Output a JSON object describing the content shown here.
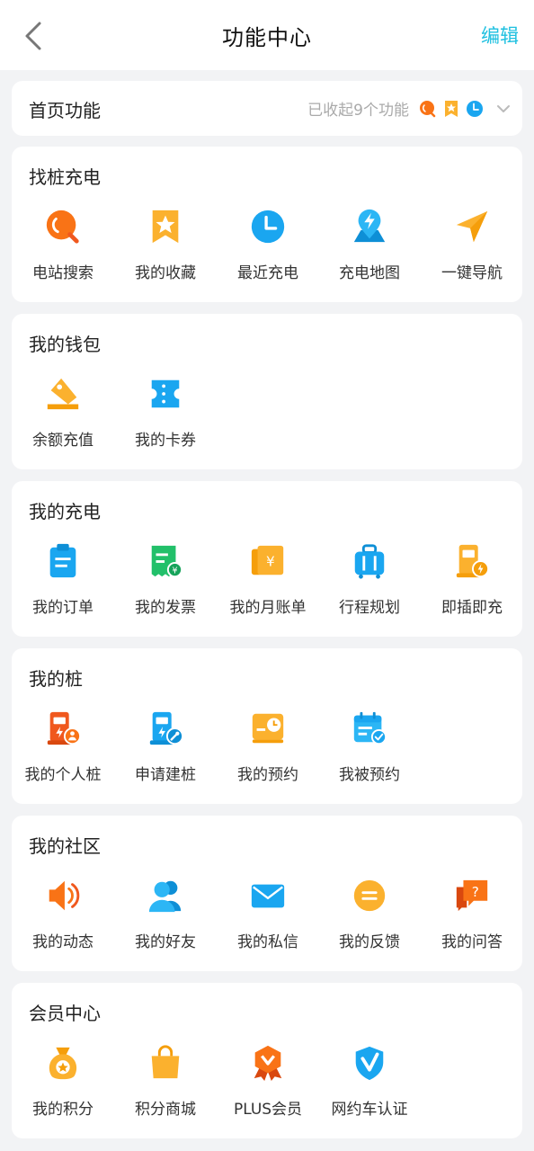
{
  "header": {
    "title": "功能中心",
    "edit_label": "编辑"
  },
  "home": {
    "title": "首页功能",
    "hint": "已收起9个功能"
  },
  "colors": {
    "accent": "#1ec0e0",
    "orange": "#f97316",
    "blue": "#1aa6f0"
  },
  "sections": [
    {
      "title": "找桩充电",
      "items": [
        {
          "label": "电站搜索",
          "icon": "station-search-icon"
        },
        {
          "label": "我的收藏",
          "icon": "favorites-icon"
        },
        {
          "label": "最近充电",
          "icon": "recent-charge-icon"
        },
        {
          "label": "充电地图",
          "icon": "charge-map-icon"
        },
        {
          "label": "一键导航",
          "icon": "navigation-icon"
        }
      ]
    },
    {
      "title": "我的钱包",
      "items": [
        {
          "label": "余额充值",
          "icon": "recharge-icon"
        },
        {
          "label": "我的卡券",
          "icon": "coupon-icon"
        }
      ]
    },
    {
      "title": "我的充电",
      "items": [
        {
          "label": "我的订单",
          "icon": "order-icon"
        },
        {
          "label": "我的发票",
          "icon": "invoice-icon"
        },
        {
          "label": "我的月账单",
          "icon": "monthly-bill-icon"
        },
        {
          "label": "行程规划",
          "icon": "trip-plan-icon"
        },
        {
          "label": "即插即充",
          "icon": "plug-charge-icon"
        }
      ]
    },
    {
      "title": "我的桩",
      "items": [
        {
          "label": "我的个人桩",
          "icon": "personal-pile-icon"
        },
        {
          "label": "申请建桩",
          "icon": "apply-pile-icon"
        },
        {
          "label": "我的预约",
          "icon": "my-booking-icon"
        },
        {
          "label": "我被预约",
          "icon": "booked-icon"
        }
      ]
    },
    {
      "title": "我的社区",
      "items": [
        {
          "label": "我的动态",
          "icon": "speaker-icon"
        },
        {
          "label": "我的好友",
          "icon": "friends-icon"
        },
        {
          "label": "我的私信",
          "icon": "mail-icon"
        },
        {
          "label": "我的反馈",
          "icon": "feedback-icon"
        },
        {
          "label": "我的问答",
          "icon": "qa-icon"
        }
      ]
    },
    {
      "title": "会员中心",
      "items": [
        {
          "label": "我的积分",
          "icon": "points-icon"
        },
        {
          "label": "积分商城",
          "icon": "shop-icon"
        },
        {
          "label": "PLUS会员",
          "icon": "plus-member-icon"
        },
        {
          "label": "网约车认证",
          "icon": "ride-hailing-cert-icon"
        }
      ]
    }
  ]
}
